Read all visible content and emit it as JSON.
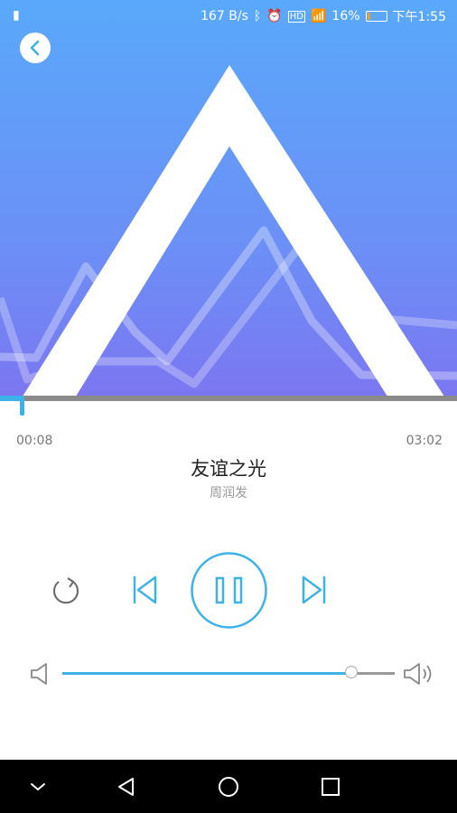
{
  "status_bar": {
    "net_speed": "167 B/s",
    "battery_percent": "16%",
    "battery_level": 0.16,
    "clock": "下午1:55",
    "icons": [
      "sim-icon",
      "vibrate-icon",
      "alarm-icon",
      "hd-icon",
      "signal-icon",
      "battery-icon"
    ]
  },
  "player": {
    "elapsed": "00:08",
    "duration": "03:02",
    "progress": 0.044,
    "song_title": "友谊之光",
    "artist": "周润发",
    "volume": 0.87,
    "accent_color": "#3cb2e6"
  },
  "controls": {
    "icons": [
      "back-icon",
      "repeat-icon",
      "previous-icon",
      "pause-icon",
      "next-icon",
      "volume-low-icon",
      "volume-high-icon"
    ]
  },
  "nav_bar": {
    "icons": [
      "nav-collapse-icon",
      "nav-back-icon",
      "nav-home-icon",
      "nav-recent-icon"
    ]
  }
}
